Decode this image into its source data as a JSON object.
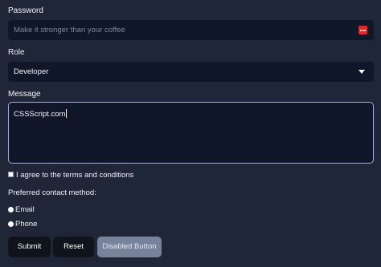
{
  "password": {
    "label": "Password",
    "placeholder": "Make it stronger than your coffee",
    "icon": "password-manager-icon"
  },
  "role": {
    "label": "Role",
    "selected": "Developer",
    "icon": "chevron-down-icon"
  },
  "message": {
    "label": "Message",
    "value": "CSSScript.com"
  },
  "terms": {
    "label": "I agree to the terms and conditions",
    "checked": false
  },
  "contact": {
    "label": "Preferred contact method:",
    "options": [
      "Email",
      "Phone"
    ]
  },
  "buttons": {
    "submit": "Submit",
    "reset": "Reset",
    "disabled": "Disabled Button"
  },
  "colors": {
    "background": "#1f2637",
    "field": "#0f1729",
    "focus_border": "#a5aedd",
    "icon_red": "#d92d2d",
    "disabled_button": "#77839a"
  }
}
